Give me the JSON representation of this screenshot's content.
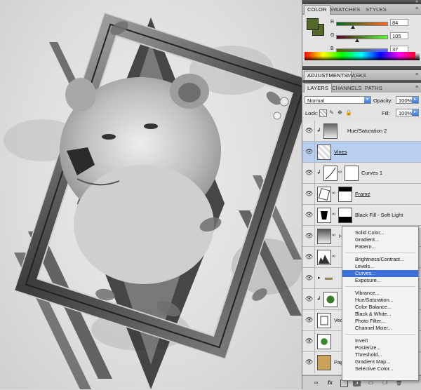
{
  "panels": {
    "color": {
      "tabs": [
        "COLOR",
        "SWATCHES",
        "STYLES"
      ],
      "channels": [
        {
          "label": "R",
          "value": "84",
          "level": 0.33
        },
        {
          "label": "G",
          "value": "105",
          "level": 0.41
        },
        {
          "label": "B",
          "value": "37",
          "level": 0.15
        }
      ],
      "foreground_color": "#546925",
      "background_color": "#546925"
    },
    "adjustments": {
      "tabs": [
        "ADJUSTMENTS",
        "MASKS"
      ]
    },
    "layers": {
      "tabs": [
        "LAYERS",
        "CHANNELS",
        "PATHS"
      ],
      "blend_mode": "Normal",
      "opacity_label": "Opacity:",
      "opacity_value": "100%",
      "lock_label": "Lock:",
      "fill_label": "Fill:",
      "fill_value": "100%",
      "items": [
        {
          "name": "Hue/Saturation 2",
          "kind": "adjustment",
          "selected": false
        },
        {
          "name": "Vines",
          "kind": "layer",
          "selected": true
        },
        {
          "name": "Curves 1",
          "kind": "adjustment",
          "selected": false
        },
        {
          "name": "Frame",
          "kind": "masked",
          "selected": false
        },
        {
          "name": "Black Fill - Soft Light",
          "kind": "masked",
          "selected": false
        },
        {
          "name": "H",
          "kind": "adjustment",
          "selected": false
        },
        {
          "name": "",
          "kind": "levels",
          "selected": false
        },
        {
          "name": "",
          "kind": "group",
          "selected": false
        },
        {
          "name": "",
          "kind": "layer",
          "selected": false
        },
        {
          "name": "Vec",
          "kind": "layer",
          "selected": false
        },
        {
          "name": "",
          "kind": "layer",
          "selected": false
        },
        {
          "name": "Pape",
          "kind": "layer",
          "selected": false
        }
      ]
    }
  },
  "adjustment_menu": {
    "groups": [
      [
        "Solid Color...",
        "Gradient...",
        "Pattern..."
      ],
      [
        "Brightness/Contrast...",
        "Levels...",
        "Curves...",
        "Exposure..."
      ],
      [
        "Vibrance...",
        "Hue/Saturation...",
        "Color Balance...",
        "Black & White...",
        "Photo Filter...",
        "Channel Mixer..."
      ],
      [
        "Invert",
        "Posterize...",
        "Threshold...",
        "Gradient Map...",
        "Selective Color..."
      ]
    ],
    "highlighted": "Curves..."
  },
  "footer_icons": [
    "link-icon",
    "fx-icon",
    "mask-icon",
    "adjustment-icon",
    "folder-icon",
    "new-layer-icon",
    "trash-icon"
  ]
}
